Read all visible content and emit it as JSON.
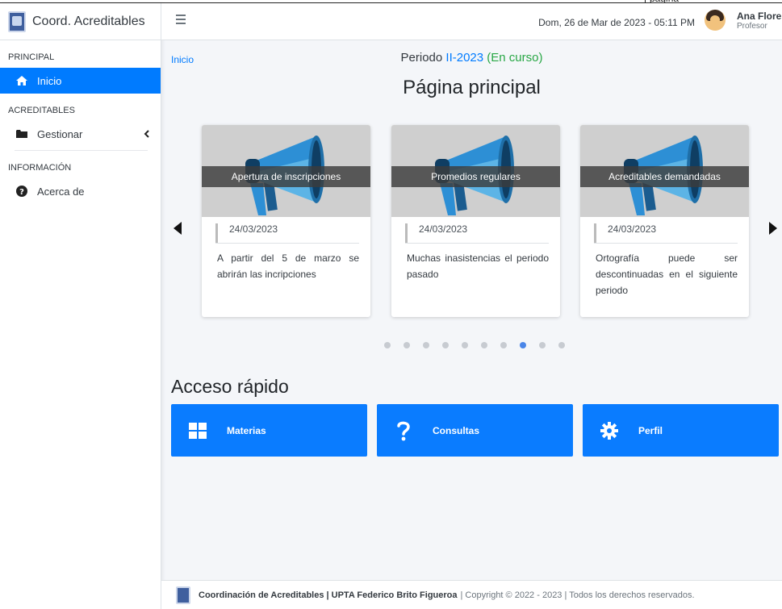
{
  "top_strip": {
    "text": "pagina"
  },
  "sidebar": {
    "brand": "Coord. Acreditables",
    "sections": [
      {
        "header": "PRINCIPAL"
      },
      {
        "header": "ACREDITABLES"
      },
      {
        "header": "INFORMACIÓN"
      }
    ],
    "items": [
      {
        "label": "Inicio",
        "icon": "home-icon",
        "active": true
      },
      {
        "label": "Gestionar",
        "icon": "folder-icon"
      },
      {
        "label": "Acerca de",
        "icon": "question-circle-icon"
      }
    ]
  },
  "header": {
    "menu_icon": "hamburger-icon",
    "datetime": "Dom, 26 de Mar de 2023 - 05:11 PM",
    "user_name": "Ana Flores",
    "user_role": "Profesor"
  },
  "main": {
    "breadcrumb": "Inicio",
    "periodo_label": "Periodo",
    "periodo_code": "II-2023",
    "periodo_status": "(En curso)",
    "title": "Página principal",
    "cards": [
      {
        "caption": "Apertura de inscripciones",
        "date": "24/03/2023",
        "text": "A partir del 5 de marzo se abrirán las incripciones"
      },
      {
        "caption": "Promedios regulares",
        "date": "24/03/2023",
        "text": "Muchas inasistencias el periodo pasado"
      },
      {
        "caption": "Acreditables demandadas",
        "date": "24/03/2023",
        "text": "Ortografía puede ser descontinuadas en el siguiente periodo"
      }
    ],
    "dots_total": 10,
    "dots_active_index": 7,
    "quick_access_title": "Acceso rápido",
    "quick_access": [
      {
        "label": "Materias",
        "icon": "grid-icon"
      },
      {
        "label": "Consultas",
        "icon": "question-icon"
      },
      {
        "label": "Perfil",
        "icon": "gear-icon"
      }
    ]
  },
  "footer": {
    "org": "Coordinación de Acreditables | UPTA Federico Brito Figueroa",
    "copyright": "| Copyright © 2022 - 2023 | Todos los derechos reservados."
  },
  "colors": {
    "primary": "#007bff",
    "success": "#28a745",
    "megaphone": "#2d8fd5"
  }
}
